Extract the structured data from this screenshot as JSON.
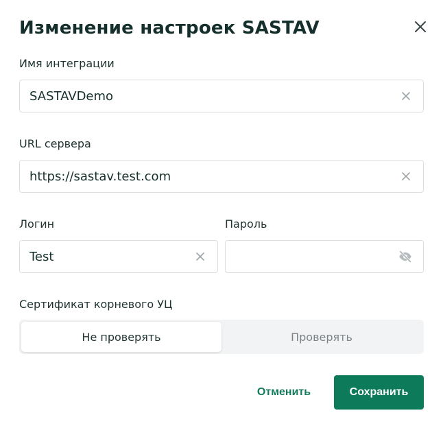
{
  "dialog": {
    "title": "Изменение настроек SASTAV",
    "close_icon": "close-icon"
  },
  "form": {
    "integration_name": {
      "label": "Имя интеграции",
      "value": "SASTAVDemo",
      "icon": "clear-icon"
    },
    "server_url": {
      "label": "URL сервера",
      "value": "https://sastav.test.com",
      "icon": "clear-icon"
    },
    "login": {
      "label": "Логин",
      "value": "Test",
      "icon": "clear-icon"
    },
    "password": {
      "label": "Пароль",
      "value": "",
      "icon": "eye-off-icon"
    },
    "root_ca": {
      "label": "Сертификат корневого УЦ",
      "options": [
        "Не проверять",
        "Проверять"
      ],
      "selected": "Не проверять"
    }
  },
  "actions": {
    "cancel_label": "Отменить",
    "save_label": "Сохранить"
  },
  "colors": {
    "accent": "#0d7a5a",
    "title": "#15302c",
    "border": "#dcdfe1",
    "segment_bg": "#f2f3f4"
  }
}
